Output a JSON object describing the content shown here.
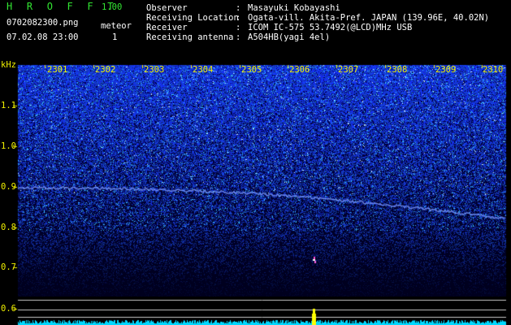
{
  "header": {
    "app_title": "H R O F F T",
    "version": "1.00",
    "filename": "0702082300.png",
    "datetime": "07.02.08 23:00",
    "meteor_label": "meteor",
    "meteor_count": "1"
  },
  "info": {
    "rows": [
      {
        "label": "Observer",
        "sep": ":",
        "value": "Masayuki Kobayashi"
      },
      {
        "label": "Receiving Location",
        "sep": ":",
        "value": "Ogata-vill. Akita-Pref. JAPAN (139.96E, 40.02N)"
      },
      {
        "label": "Receiver",
        "sep": ":",
        "value": "ICOM IC-575 53.7492(@LCD)MHz USB"
      },
      {
        "label": "Receiving antenna",
        "sep": ":",
        "value": "A504HB(yagi 4el)"
      }
    ]
  },
  "chart_data": {
    "type": "heatmap",
    "ylabel": "kHz",
    "y_ticks": [
      "1.1",
      "1.0",
      "0.9",
      "0.8",
      "0.7",
      "0.6"
    ],
    "x_ticks": [
      "2301",
      "2302",
      "2303",
      "2304",
      "2305",
      "2306",
      "2307",
      "2308",
      "2309",
      "2310"
    ],
    "meteor_events": [
      {
        "time": "2306.2",
        "freq_khz": 0.71
      }
    ]
  },
  "colors": {
    "label_green": "#32e632",
    "label_yellow": "#f0f000",
    "noise_blue": "#1a2cff",
    "level_cyan": "#00d8ff",
    "meteor_yellow": "#ffff00"
  }
}
